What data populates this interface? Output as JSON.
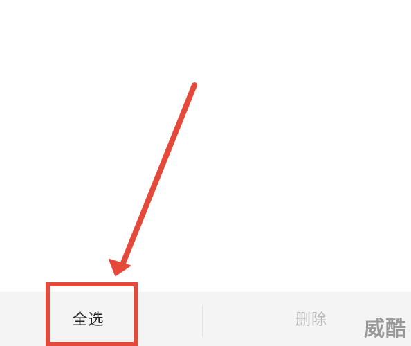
{
  "bottom_bar": {
    "select_all_label": "全选",
    "delete_label": "删除"
  },
  "annotation": {
    "color": "#e4493a",
    "type": "arrow-pointing-to-select-all"
  },
  "watermark": {
    "text": "威酷"
  },
  "colors": {
    "bar_background": "#f4f4f4",
    "active_text": "#222222",
    "disabled_text": "#b8b8b8"
  }
}
